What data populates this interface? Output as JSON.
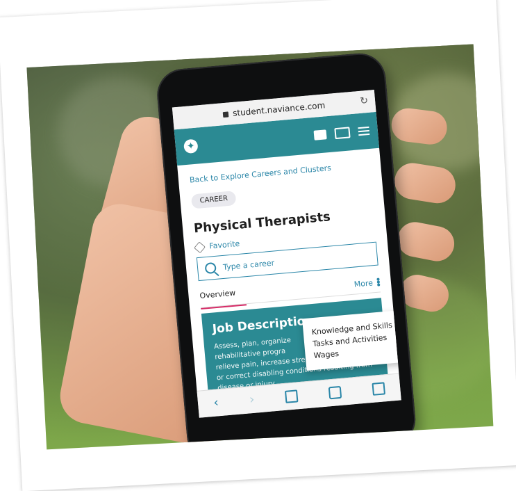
{
  "browser": {
    "url": "student.naviance.com"
  },
  "page": {
    "back_link": "Back to Explore Careers and Clusters",
    "badge": "CAREER",
    "title": "Physical Therapists",
    "favorite_label": "Favorite",
    "search_placeholder": "Type a career",
    "tab_overview": "Overview",
    "more_label": "More",
    "dropdown_items": [
      "Knowledge and Skills",
      "Tasks and Activities",
      "Wages"
    ],
    "job_description_title": "Job Descriptio",
    "job_description_text_lines": [
      "Assess, plan, organize",
      "rehabilitative progra",
      "relieve pain, increase strength, and improve",
      "or correct disabling conditions resulting from",
      "disease or injury."
    ]
  },
  "colors": {
    "teal": "#2b8a93",
    "link": "#2a86a8",
    "accent_pink": "#d62a66"
  },
  "icons": {
    "lock": "lock-icon",
    "reload": "reload-icon",
    "logo": "logo-icon",
    "chat": "chat-icon",
    "mail": "mail-icon",
    "menu": "menu-icon",
    "heart": "heart-icon",
    "search": "search-icon",
    "more_dots": "kebab-menu-icon",
    "back": "back-arrow-icon",
    "forward": "forward-arrow-icon",
    "share": "share-icon",
    "bookmarks": "bookmarks-icon",
    "tabs": "tabs-icon"
  }
}
